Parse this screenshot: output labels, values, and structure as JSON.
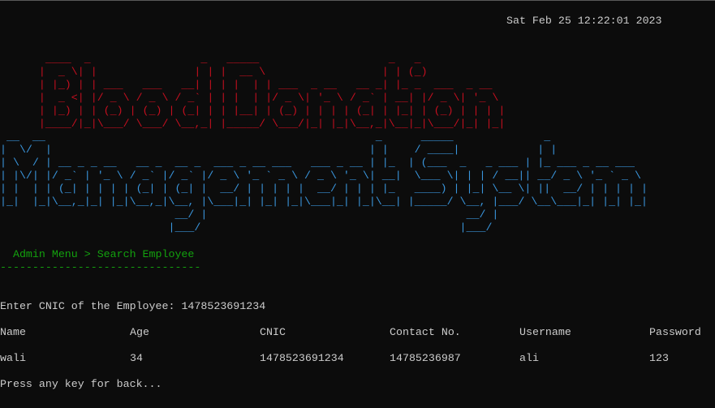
{
  "datetime": "Sat Feb 25 12:22:01 2023",
  "banner": {
    "line1_text": "Blood Donation",
    "line2_text": "Management System",
    "line1_art": "       ____  _                 _   _____                    _   _               \n      |  _ \\| |               | | |  __ \\                  | | (_)              \n      | |_) | | ___   ___   __| | | |  | | ___  _ __   __ _| |_ _  ___  _ __    \n      |  _ <| |/ _ \\ / _ \\ / _` | | |  | |/ _ \\| '_ \\ / _` | __| |/ _ \\| '_ \\   \n      | |_) | | (_) | (_) | (_| | | |__| | (_) | | | | (_| | |_| | (_) | | | |  \n      |____/|_|\\___/ \\___/ \\__,_| |_____/ \\___/|_| |_|\\__,_|\\__|_|\\___/|_| |_|  ",
    "line2_art": " __  __                                                   _      _____              _                  \n|  \\/  |                                                 | |    / ____|            | |                 \n| \\  / | __ _ _ __   __ _  __ _  ___ _ __ ___   ___ _ __ | |_  | (___  _   _ ___ | |_ ___ _ __ ___   \n| |\\/| |/ _` | '_ \\ / _` |/ _` |/ _ \\ '_ ` _ \\ / _ \\ '_ \\| __|  \\___ \\| | | / __|| __/ _ \\ '_ ` _ \\  \n| |  | | (_| | | | | (_| | (_| |  __/ | | | | |  __/ | | | |_   ____) | |_| \\__ \\| ||  __/ | | | | | \n|_|  |_|\\__,_|_| |_|\\__,_|\\__, |\\___|_| |_| |_|\\___|_| |_|\\__| |_____/ \\__, |___/ \\__\\___|_| |_| |_| \n                           __/ |                                        __/ |                          \n                          |___/                                        |___/                           "
  },
  "breadcrumb": "  Admin Menu > Search Employee",
  "rule": "-------------------------------",
  "prompt": {
    "label": "Enter CNIC of the Employee: ",
    "value": "1478523691234"
  },
  "table": {
    "headers": [
      "Name",
      "Age",
      "CNIC",
      "Contact No.",
      "Username",
      "Password"
    ],
    "rows": [
      [
        "wali",
        "34",
        "1478523691234",
        "14785236987",
        "ali",
        "123"
      ]
    ]
  },
  "back_prompt": "Press any key for back...",
  "colors": {
    "background": "#0c0c0c",
    "text": "#cccccc",
    "banner_red": "#c50f1f",
    "banner_blue": "#3a96dd",
    "menu_green": "#13a10e"
  }
}
